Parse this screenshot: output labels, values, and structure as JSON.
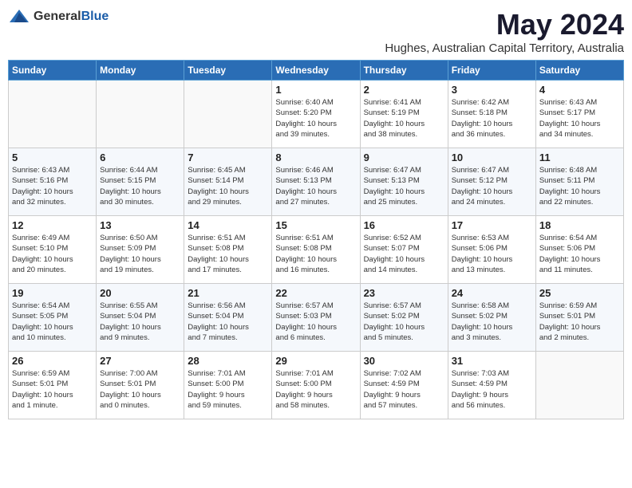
{
  "header": {
    "logo": {
      "text_general": "General",
      "text_blue": "Blue"
    },
    "month": "May 2024",
    "location": "Hughes, Australian Capital Territory, Australia"
  },
  "weekdays": [
    "Sunday",
    "Monday",
    "Tuesday",
    "Wednesday",
    "Thursday",
    "Friday",
    "Saturday"
  ],
  "weeks": [
    {
      "days": [
        {
          "num": "",
          "info": ""
        },
        {
          "num": "",
          "info": ""
        },
        {
          "num": "",
          "info": ""
        },
        {
          "num": "1",
          "info": "Sunrise: 6:40 AM\nSunset: 5:20 PM\nDaylight: 10 hours\nand 39 minutes."
        },
        {
          "num": "2",
          "info": "Sunrise: 6:41 AM\nSunset: 5:19 PM\nDaylight: 10 hours\nand 38 minutes."
        },
        {
          "num": "3",
          "info": "Sunrise: 6:42 AM\nSunset: 5:18 PM\nDaylight: 10 hours\nand 36 minutes."
        },
        {
          "num": "4",
          "info": "Sunrise: 6:43 AM\nSunset: 5:17 PM\nDaylight: 10 hours\nand 34 minutes."
        }
      ]
    },
    {
      "days": [
        {
          "num": "5",
          "info": "Sunrise: 6:43 AM\nSunset: 5:16 PM\nDaylight: 10 hours\nand 32 minutes."
        },
        {
          "num": "6",
          "info": "Sunrise: 6:44 AM\nSunset: 5:15 PM\nDaylight: 10 hours\nand 30 minutes."
        },
        {
          "num": "7",
          "info": "Sunrise: 6:45 AM\nSunset: 5:14 PM\nDaylight: 10 hours\nand 29 minutes."
        },
        {
          "num": "8",
          "info": "Sunrise: 6:46 AM\nSunset: 5:13 PM\nDaylight: 10 hours\nand 27 minutes."
        },
        {
          "num": "9",
          "info": "Sunrise: 6:47 AM\nSunset: 5:13 PM\nDaylight: 10 hours\nand 25 minutes."
        },
        {
          "num": "10",
          "info": "Sunrise: 6:47 AM\nSunset: 5:12 PM\nDaylight: 10 hours\nand 24 minutes."
        },
        {
          "num": "11",
          "info": "Sunrise: 6:48 AM\nSunset: 5:11 PM\nDaylight: 10 hours\nand 22 minutes."
        }
      ]
    },
    {
      "days": [
        {
          "num": "12",
          "info": "Sunrise: 6:49 AM\nSunset: 5:10 PM\nDaylight: 10 hours\nand 20 minutes."
        },
        {
          "num": "13",
          "info": "Sunrise: 6:50 AM\nSunset: 5:09 PM\nDaylight: 10 hours\nand 19 minutes."
        },
        {
          "num": "14",
          "info": "Sunrise: 6:51 AM\nSunset: 5:08 PM\nDaylight: 10 hours\nand 17 minutes."
        },
        {
          "num": "15",
          "info": "Sunrise: 6:51 AM\nSunset: 5:08 PM\nDaylight: 10 hours\nand 16 minutes."
        },
        {
          "num": "16",
          "info": "Sunrise: 6:52 AM\nSunset: 5:07 PM\nDaylight: 10 hours\nand 14 minutes."
        },
        {
          "num": "17",
          "info": "Sunrise: 6:53 AM\nSunset: 5:06 PM\nDaylight: 10 hours\nand 13 minutes."
        },
        {
          "num": "18",
          "info": "Sunrise: 6:54 AM\nSunset: 5:06 PM\nDaylight: 10 hours\nand 11 minutes."
        }
      ]
    },
    {
      "days": [
        {
          "num": "19",
          "info": "Sunrise: 6:54 AM\nSunset: 5:05 PM\nDaylight: 10 hours\nand 10 minutes."
        },
        {
          "num": "20",
          "info": "Sunrise: 6:55 AM\nSunset: 5:04 PM\nDaylight: 10 hours\nand 9 minutes."
        },
        {
          "num": "21",
          "info": "Sunrise: 6:56 AM\nSunset: 5:04 PM\nDaylight: 10 hours\nand 7 minutes."
        },
        {
          "num": "22",
          "info": "Sunrise: 6:57 AM\nSunset: 5:03 PM\nDaylight: 10 hours\nand 6 minutes."
        },
        {
          "num": "23",
          "info": "Sunrise: 6:57 AM\nSunset: 5:02 PM\nDaylight: 10 hours\nand 5 minutes."
        },
        {
          "num": "24",
          "info": "Sunrise: 6:58 AM\nSunset: 5:02 PM\nDaylight: 10 hours\nand 3 minutes."
        },
        {
          "num": "25",
          "info": "Sunrise: 6:59 AM\nSunset: 5:01 PM\nDaylight: 10 hours\nand 2 minutes."
        }
      ]
    },
    {
      "days": [
        {
          "num": "26",
          "info": "Sunrise: 6:59 AM\nSunset: 5:01 PM\nDaylight: 10 hours\nand 1 minute."
        },
        {
          "num": "27",
          "info": "Sunrise: 7:00 AM\nSunset: 5:01 PM\nDaylight: 10 hours\nand 0 minutes."
        },
        {
          "num": "28",
          "info": "Sunrise: 7:01 AM\nSunset: 5:00 PM\nDaylight: 9 hours\nand 59 minutes."
        },
        {
          "num": "29",
          "info": "Sunrise: 7:01 AM\nSunset: 5:00 PM\nDaylight: 9 hours\nand 58 minutes."
        },
        {
          "num": "30",
          "info": "Sunrise: 7:02 AM\nSunset: 4:59 PM\nDaylight: 9 hours\nand 57 minutes."
        },
        {
          "num": "31",
          "info": "Sunrise: 7:03 AM\nSunset: 4:59 PM\nDaylight: 9 hours\nand 56 minutes."
        },
        {
          "num": "",
          "info": ""
        }
      ]
    }
  ]
}
